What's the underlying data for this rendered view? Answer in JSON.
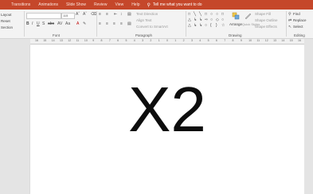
{
  "tabs": [
    "Transitions",
    "Animations",
    "Slide Show",
    "Review",
    "View",
    "Help"
  ],
  "tell_me": "Tell me what you want to do",
  "ribbon": {
    "left_items": [
      "Layout",
      "Reset",
      "Section"
    ],
    "font_group_label": "Font",
    "paragraph_group_label": "Paragraph",
    "drawing_group_label": "Drawing",
    "editing_group_label": "Editing",
    "font_size_value": "115",
    "text_direction": "Text Direction",
    "align_text": "Align Text",
    "convert_smartart": "Convert to SmartArt",
    "arrange": "Arrange",
    "quick_styles": "Quick Styles",
    "shape_fill": "Shape Fill",
    "shape_outline": "Shape Outline",
    "shape_effects": "Shape Effects",
    "find": "Find",
    "replace": "Replace",
    "select": "Select"
  },
  "ruler_numbers": [
    "16",
    "15",
    "14",
    "13",
    "12",
    "11",
    "10",
    "9",
    "8",
    "7",
    "6",
    "5",
    "4",
    "3",
    "2",
    "1",
    "0",
    "1",
    "2",
    "3",
    "4",
    "5",
    "6",
    "7",
    "8",
    "9",
    "10",
    "11",
    "12",
    "13",
    "14",
    "15",
    "16"
  ],
  "slide": {
    "text": "X2"
  },
  "colors": {
    "accent": "#c5472a",
    "ribbon_bg": "#f3f3f3",
    "workspace_bg": "#e4e4e4"
  }
}
